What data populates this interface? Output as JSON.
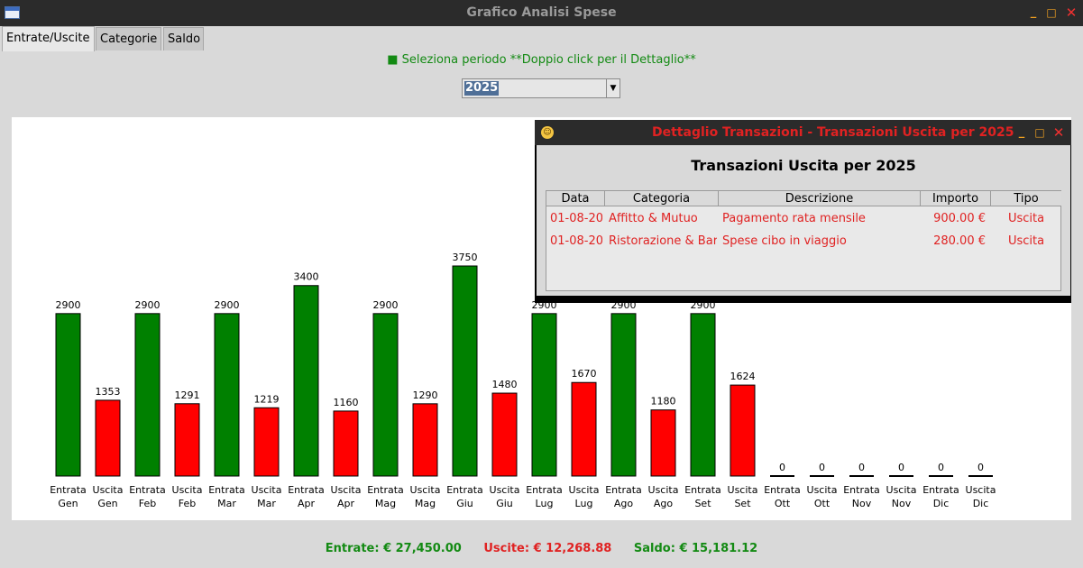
{
  "window": {
    "title": "Grafico Analisi Spese",
    "minimize_icon": "minimize-icon",
    "maximize_icon": "maximize-icon",
    "close_icon": "close-icon"
  },
  "tabs": [
    {
      "label": "Entrate/Uscite",
      "active": true
    },
    {
      "label": "Categorie",
      "active": false
    },
    {
      "label": "Saldo",
      "active": false
    }
  ],
  "hint": "■ Seleziona periodo **Doppio click per il Dettaglio**",
  "period_select": {
    "value": "2025"
  },
  "colors": {
    "entrata": "#008000",
    "uscita": "#ff0000",
    "accent_red": "#e02222"
  },
  "chart_data": {
    "type": "bar",
    "categories": [
      "Entrata Gen",
      "Uscita Gen",
      "Entrata Feb",
      "Uscita Feb",
      "Entrata Mar",
      "Uscita Mar",
      "Entrata Apr",
      "Uscita Apr",
      "Entrata Mag",
      "Uscita Mag",
      "Entrata Giu",
      "Uscita Giu",
      "Entrata Lug",
      "Uscita Lug",
      "Entrata Ago",
      "Uscita Ago",
      "Entrata Set",
      "Uscita Set",
      "Entrata Ott",
      "Uscita Ott",
      "Entrata Nov",
      "Uscita Nov",
      "Entrata Dic",
      "Uscita Dic"
    ],
    "values": [
      2900,
      1353,
      2900,
      1291,
      2900,
      1219,
      3400,
      1160,
      2900,
      1290,
      3750,
      1480,
      2900,
      1670,
      2900,
      1180,
      2900,
      1624,
      0,
      0,
      0,
      0,
      0,
      0
    ],
    "ylim": [
      0,
      3750
    ],
    "grid": false
  },
  "summary": {
    "entrate": "Entrate: € 27,450.00",
    "uscite": "Uscite: € 12,268.88",
    "saldo": "Saldo: € 15,181.12"
  },
  "detail_dialog": {
    "title": "Dettaglio Transazioni - Transazioni Uscita per 2025",
    "heading": "Transazioni Uscita per 2025",
    "columns": [
      "Data",
      "Categoria",
      "Descrizione",
      "Importo",
      "Tipo"
    ],
    "rows": [
      {
        "data": "01-08-20",
        "categoria": "Affitto & Mutuo",
        "descrizione": "Pagamento rata mensile",
        "importo": "900.00 €",
        "tipo": "Uscita"
      },
      {
        "data": "01-08-20",
        "categoria": "Ristorazione & Bar",
        "descrizione": "Spese cibo in viaggio",
        "importo": "280.00 €",
        "tipo": "Uscita"
      }
    ]
  }
}
